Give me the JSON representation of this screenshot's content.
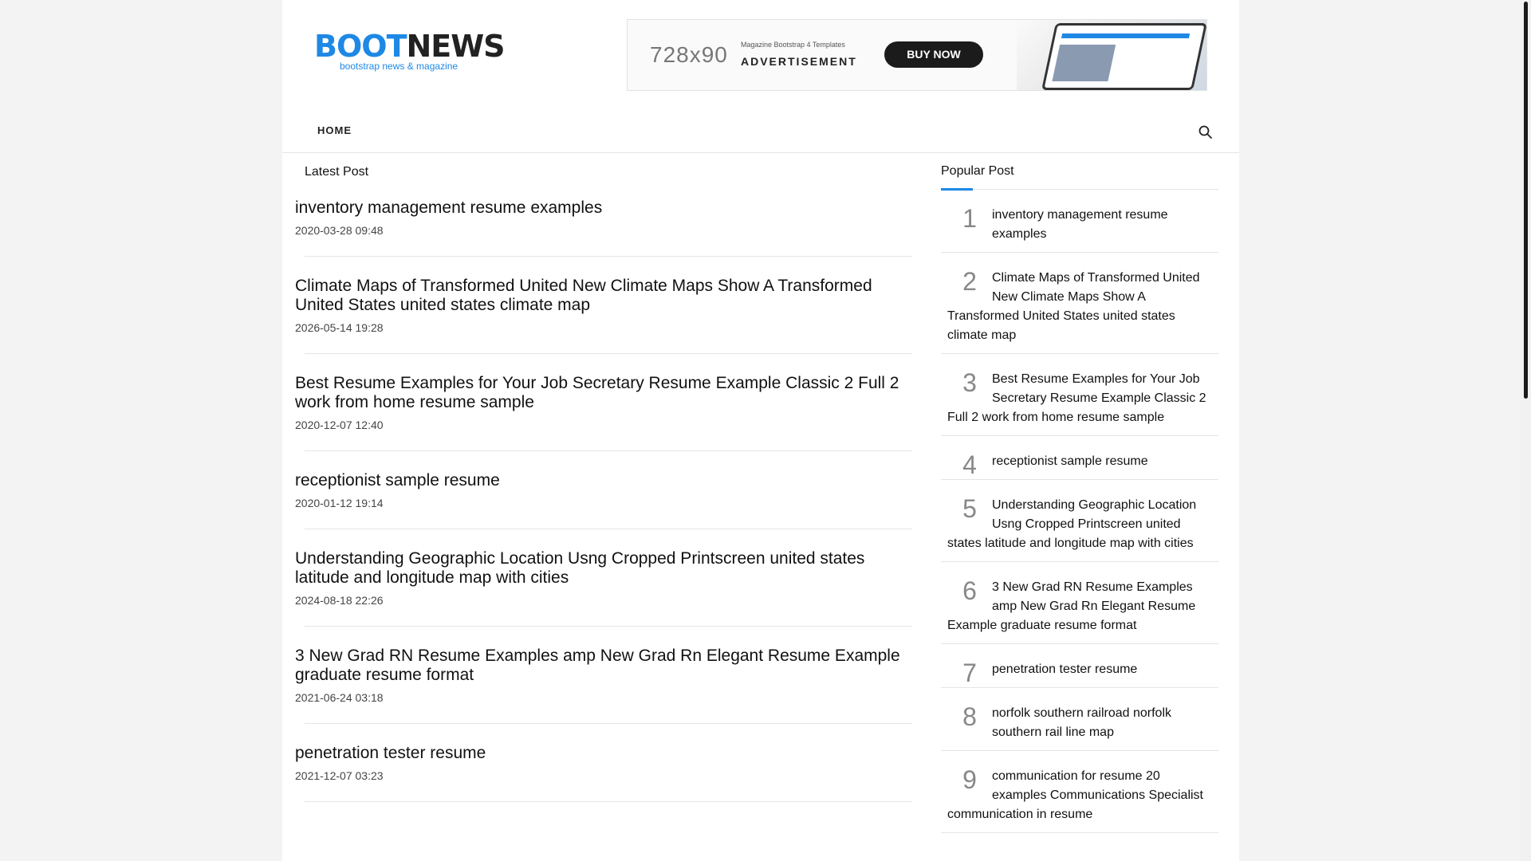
{
  "header": {
    "logo_boot": "BOOT",
    "logo_news": "NEWS",
    "logo_tagline": "bootstrap news & magazine",
    "ad": {
      "size": "728x90",
      "subtitle": "Magazine Bootstrap 4 Templates",
      "label": "ADVERTISEMENT",
      "button": "BUY NOW"
    }
  },
  "nav": {
    "home": "HOME",
    "search_icon": "search-icon"
  },
  "latest": {
    "title": "Latest Post",
    "posts": [
      {
        "title": "inventory management resume examples",
        "date": "2020-03-28 09:48"
      },
      {
        "title": "Climate Maps of Transformed United New Climate Maps Show A Transformed United States united states climate map",
        "date": "2026-05-14 19:28"
      },
      {
        "title": "Best Resume Examples for Your Job Secretary Resume Example Classic 2 Full 2 work from home resume sample",
        "date": "2020-12-07 12:40"
      },
      {
        "title": "receptionist sample resume",
        "date": "2020-01-12 19:14"
      },
      {
        "title": "Understanding Geographic Location Usng Cropped Printscreen united states latitude and longitude map with cities",
        "date": "2024-08-18 22:26"
      },
      {
        "title": "3 New Grad RN Resume Examples amp New Grad Rn Elegant Resume Example graduate resume format",
        "date": "2021-06-24 03:18"
      },
      {
        "title": "penetration tester resume",
        "date": "2021-12-07 03:23"
      }
    ]
  },
  "popular": {
    "title": "Popular Post",
    "items": [
      {
        "num": "1",
        "title": "inventory management resume examples"
      },
      {
        "num": "2",
        "title": "Climate Maps of Transformed United New Climate Maps Show A Transformed United States united states climate map"
      },
      {
        "num": "3",
        "title": "Best Resume Examples for Your Job Secretary Resume Example Classic 2 Full 2 work from home resume sample"
      },
      {
        "num": "4",
        "title": "receptionist sample resume"
      },
      {
        "num": "5",
        "title": "Understanding Geographic Location Usng Cropped Printscreen united states latitude and longitude map with cities"
      },
      {
        "num": "6",
        "title": "3 New Grad RN Resume Examples amp New Grad Rn Elegant Resume Example graduate resume format"
      },
      {
        "num": "7",
        "title": "penetration tester resume"
      },
      {
        "num": "8",
        "title": "norfolk southern railroad norfolk southern rail line map"
      },
      {
        "num": "9",
        "title": "communication for resume 20 examples Communications Specialist communication in resume"
      }
    ]
  },
  "colors": {
    "accent": "#1e88e5",
    "background": "#f3f3f3"
  }
}
